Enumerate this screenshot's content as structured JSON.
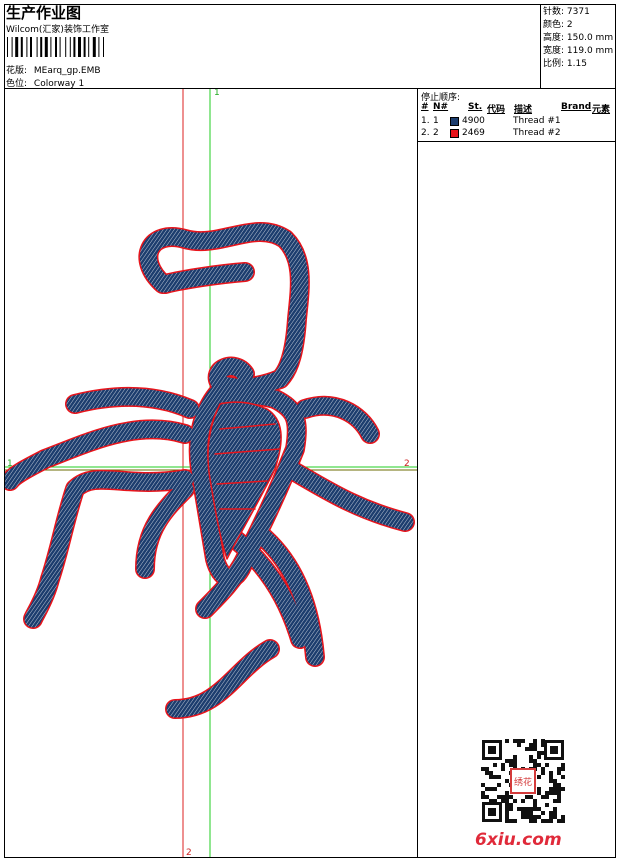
{
  "header": {
    "title": "生产作业图",
    "studio": "Wilcom(汇家)装饰工作室",
    "design_label": "花版:",
    "design_value": "MEarq_gp.EMB",
    "colorway_label": "色位:",
    "colorway_value": "Colorway 1"
  },
  "stats": {
    "stitches_label": "针数:",
    "stitches_value": "7371",
    "colors_label": "颜色:",
    "colors_value": "2",
    "height_label": "高度:",
    "height_value": "150.0 mm",
    "width_label": "宽度:",
    "width_value": "119.0 mm",
    "scale_label": "比例:",
    "scale_value": "1.15"
  },
  "stop_sequence": {
    "title": "停止顺序:",
    "columns": [
      "#",
      "N#",
      "St.",
      "代码",
      "描述",
      "Brand",
      "元素"
    ],
    "rows": [
      {
        "index": "1.",
        "needle": "1",
        "code": "4900",
        "desc": "Thread #1",
        "color": "#1c3d6e"
      },
      {
        "index": "2.",
        "needle": "2",
        "code": "2469",
        "desc": "Thread #2",
        "color": "#e8141b"
      }
    ]
  },
  "axes": {
    "v_top": "1",
    "v_bottom": "2",
    "h_left": "1",
    "h_right": "2"
  },
  "watermark": {
    "seal_text": "绣花",
    "site": "6xiu.com"
  },
  "colors": {
    "thread1": "#1c3d6e",
    "thread2": "#e8141b",
    "axis_green": "#22cc22",
    "axis_red": "#dd2222",
    "axis_olive": "#6b6b00"
  }
}
